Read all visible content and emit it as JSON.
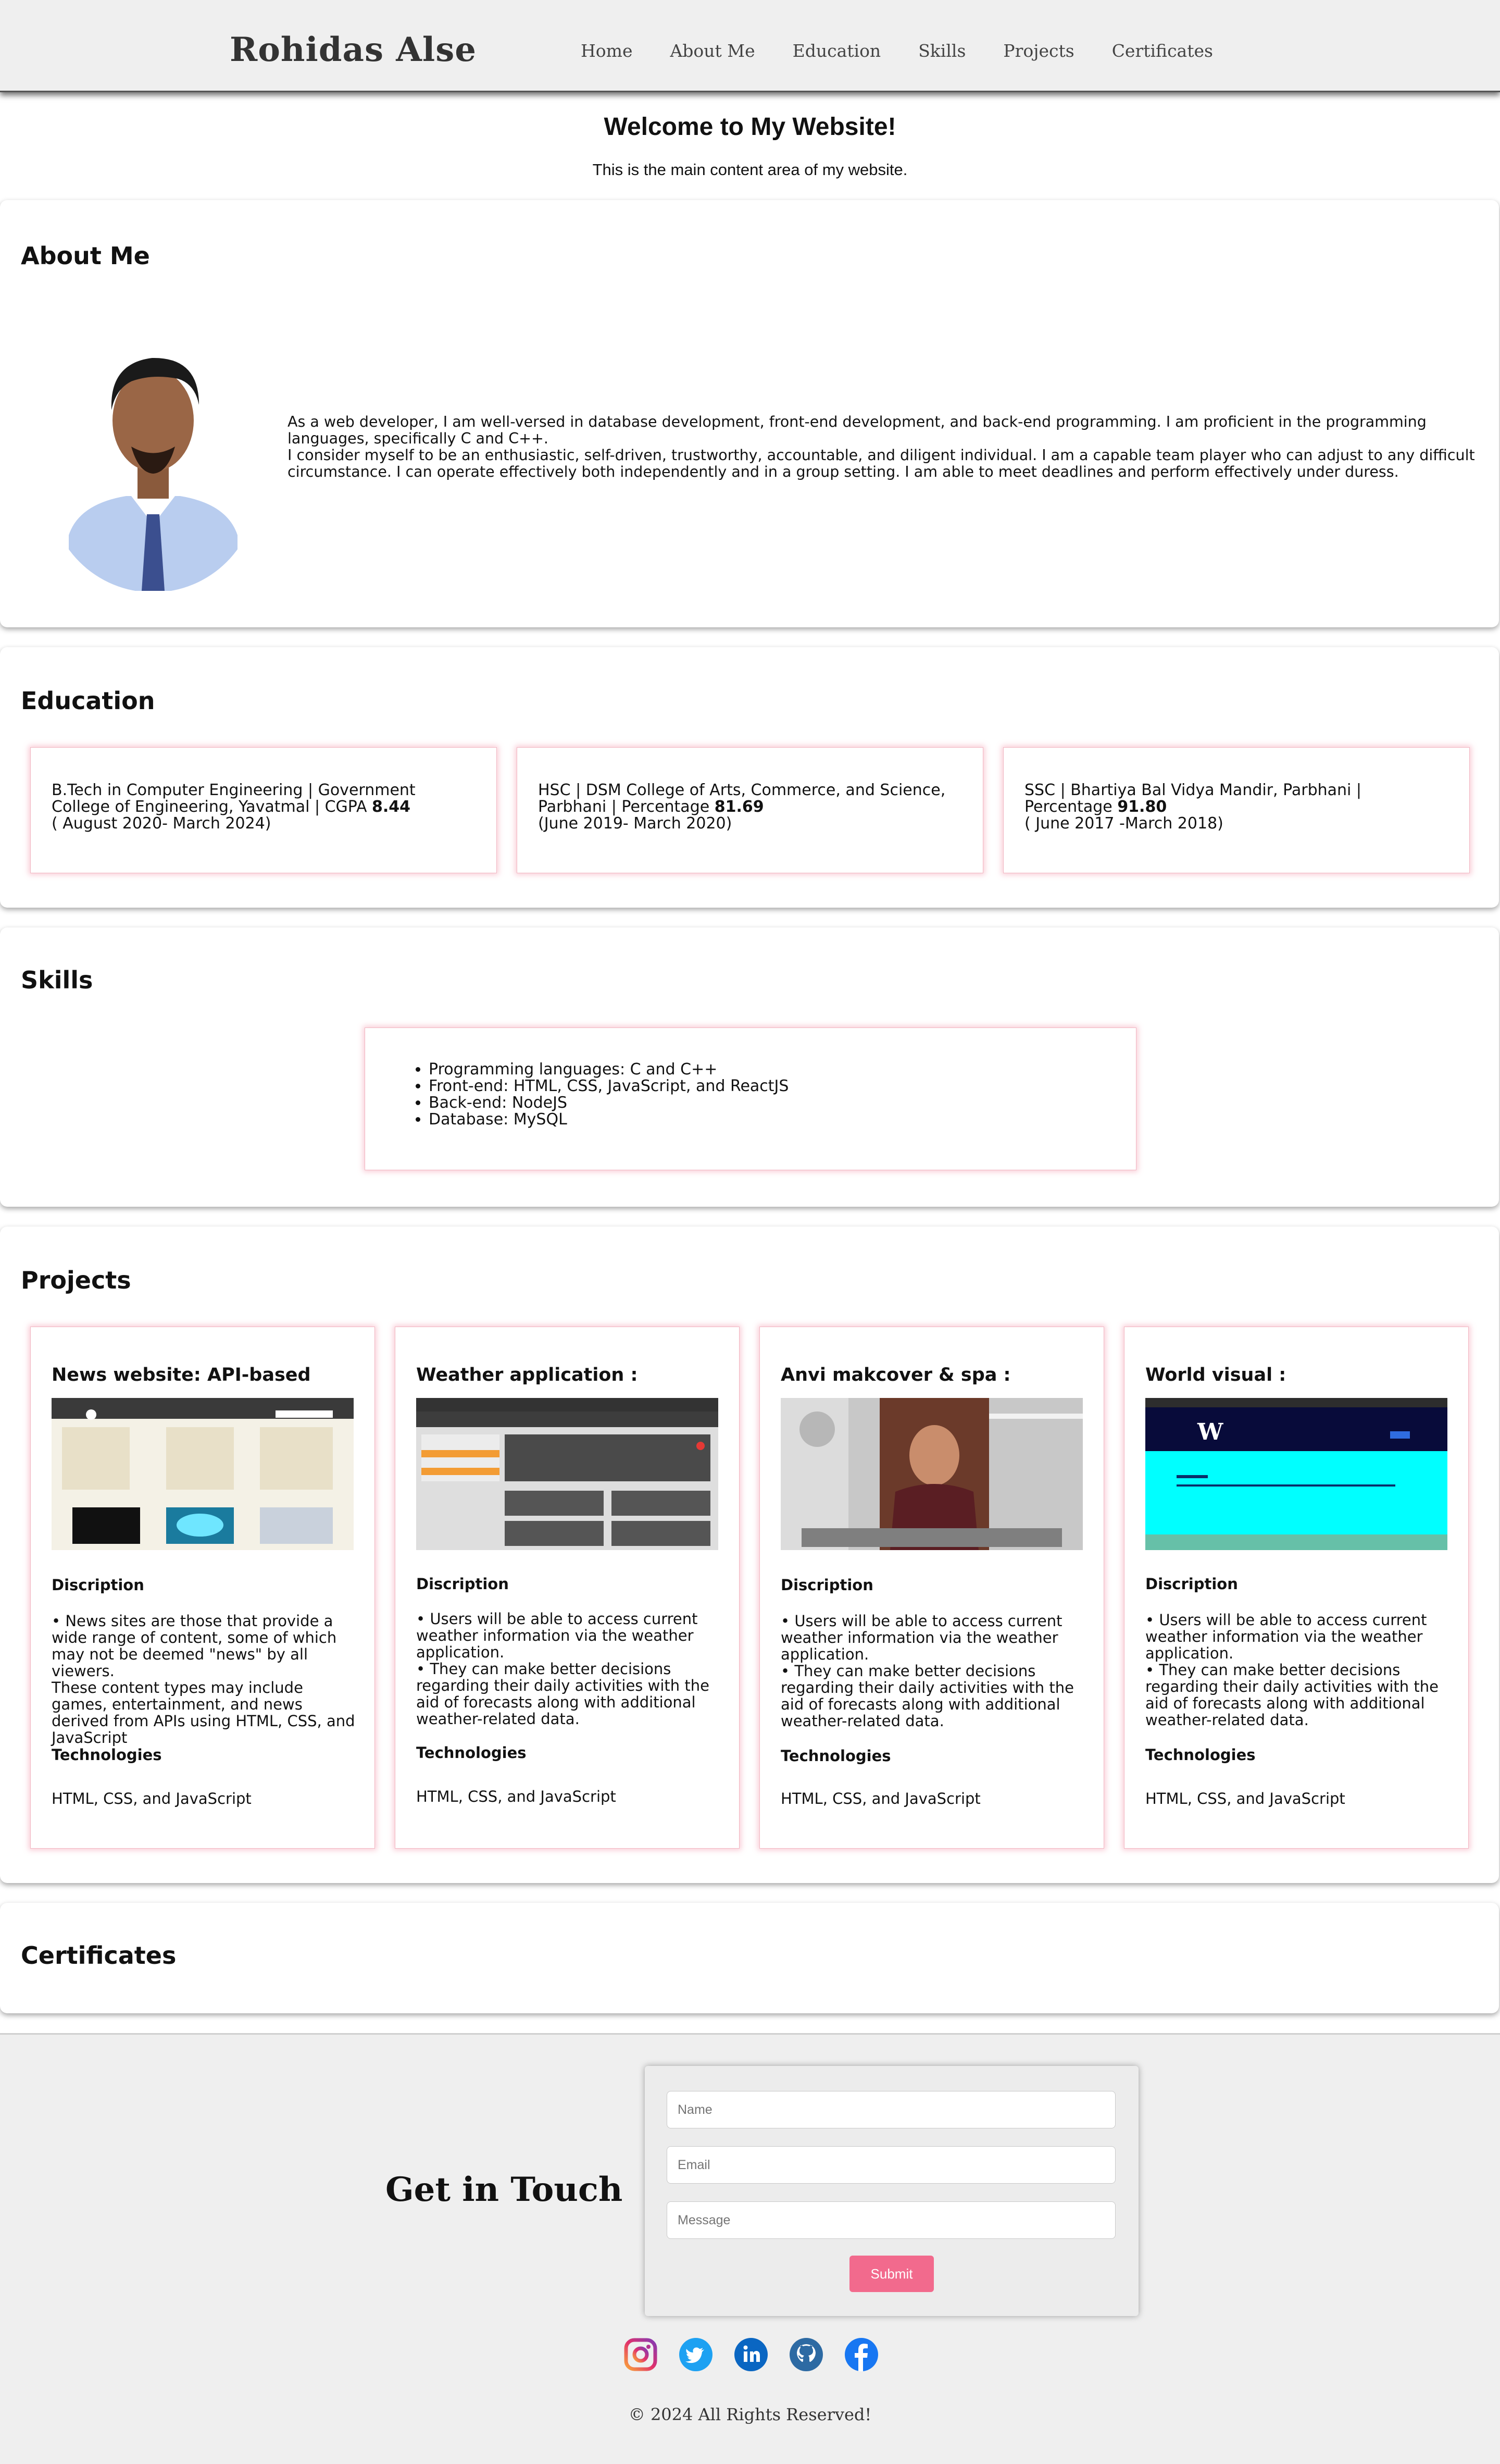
{
  "header": {
    "brand": "Rohidas Alse",
    "nav": [
      "Home",
      "About Me",
      "Education",
      "Skills",
      "Projects",
      "Certificates"
    ]
  },
  "welcome": {
    "title": "Welcome to My Website!",
    "subtitle": "This is the main content area of my website."
  },
  "about": {
    "title": "About Me",
    "text1": "As a web developer, I am well-versed in database development, front-end development, and back-end programming. I am proficient in the programming languages, specifically C and C++.",
    "text2": "I consider myself to be an enthusiastic, self-driven, trustworthy, accountable, and diligent individual. I am a capable team player who can adjust to any difficult circumstance. I can operate effectively both independently and in a group setting. I am able to meet deadlines and perform effectively under duress."
  },
  "education": {
    "title": "Education",
    "items": [
      {
        "line1": "B.Tech in Computer Engineering | Government College of Engineering, Yavatmal | CGPA ",
        "score": "8.44",
        "line2": "( August 2020- March 2024)"
      },
      {
        "line1": "HSC | DSM College of Arts, Commerce, and Science, Parbhani | Percentage ",
        "score": "81.69",
        "line2": "(June 2019- March 2020)"
      },
      {
        "line1": "SSC | Bhartiya Bal Vidya Mandir, Parbhani | Percentage ",
        "score": "91.80",
        "line2": "( June 2017 -March 2018)"
      }
    ]
  },
  "skills": {
    "title": "Skills",
    "items": [
      "Programming languages: C and C++",
      "Front-end: HTML, CSS, JavaScript, and ReactJS",
      "Back-end: NodeJS",
      "Database: MySQL"
    ]
  },
  "projects": {
    "title": "Projects",
    "desc_label": "Discription",
    "tech_label": "Technologies",
    "items": [
      {
        "title": "News website: API-based",
        "desc": "• News sites are those that provide a wide range of content, some of which may not be deemed \"news\" by all viewers.",
        "desc2": "These content types may include games, entertainment, and news derived from APIs using HTML, CSS, and JavaScript",
        "tech": "HTML, CSS, and JavaScript"
      },
      {
        "title": "Weather application :",
        "desc": "• Users will be able to access current weather information via the weather application.",
        "desc2": "• They can make better decisions regarding their daily activities with the aid of forecasts along with additional weather-related data.",
        "tech": "HTML, CSS, and JavaScript"
      },
      {
        "title": "Anvi makcover & spa :",
        "desc": "• Users will be able to access current weather information via the weather application.",
        "desc2": "• They can make better decisions regarding their daily activities with the aid of forecasts along with additional weather-related data.",
        "tech": "HTML, CSS, and JavaScript"
      },
      {
        "title": "World visual :",
        "desc": "• Users will be able to access current weather information via the weather application.",
        "desc2": "• They can make better decisions regarding their daily activities with the aid of forecasts along with additional weather-related data.",
        "tech": "HTML, CSS, and JavaScript"
      }
    ]
  },
  "certificates": {
    "title": "Certificates"
  },
  "contact": {
    "title": "Get in Touch",
    "name_placeholder": "Name",
    "email_placeholder": "Email",
    "message_placeholder": "Message",
    "submit": "Submit"
  },
  "socials": [
    "instagram-icon",
    "twitter-icon",
    "linkedin-icon",
    "github-icon",
    "facebook-icon"
  ],
  "colors": {
    "accent": "#f26a8d",
    "card_glow": "#f0a0b4",
    "footer_bg": "#efefef",
    "twitter": "#1da1f2",
    "linkedin": "#0a66c2",
    "facebook": "#1877f2"
  },
  "footer": {
    "copyright": "© 2024 All Rights Reserved!"
  }
}
